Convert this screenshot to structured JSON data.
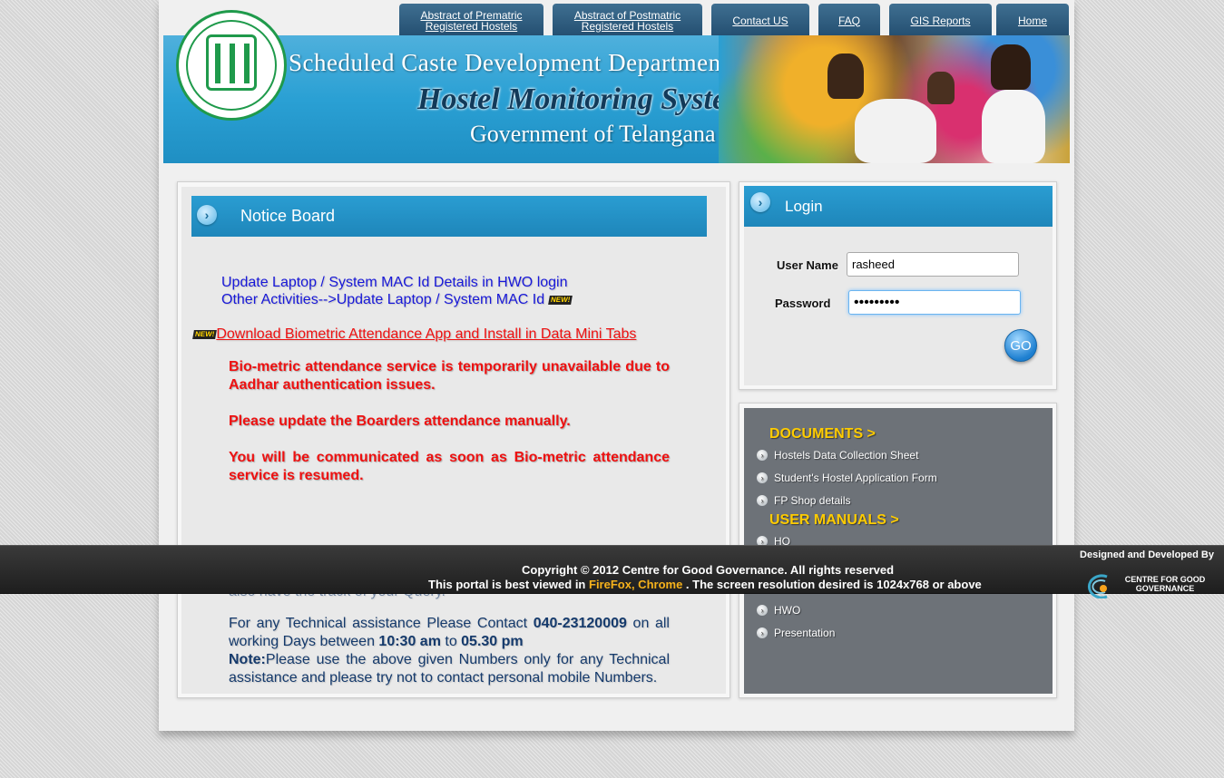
{
  "nav": {
    "items": [
      {
        "line1": "Abstract of Prematric",
        "line2": "Registered Hostels"
      },
      {
        "line1": "Abstract of Postmatric",
        "line2": "Registered Hostels"
      },
      {
        "line1": "Contact US",
        "line2": ""
      },
      {
        "line1": "FAQ",
        "line2": ""
      },
      {
        "line1": "GIS Reports",
        "line2": ""
      },
      {
        "line1": "Home",
        "line2": ""
      }
    ]
  },
  "banner": {
    "line1": "Scheduled Caste Development Department",
    "line2": "Hostel Monitoring System",
    "line3": "Government of Telangana"
  },
  "notice": {
    "title": "Notice Board",
    "mac_line1": "Update Laptop / System MAC Id Details in HWO login",
    "mac_line2": "Other Activities-->Update Laptop / System MAC Id",
    "new_badge": "NEW!",
    "download_link": "Download Biometric Attendance App and Install in Data Mini Tabs",
    "red_para1": "Bio-metric attendance service is temporarily unavailable due to Aadhar authentication issues.",
    "red_para2": "Please update the Boarders attendance manually.",
    "red_para3": "You will be communicated as soon as Bio-metric attendance service is resumed.",
    "partial_line": "also have the track of your Query.",
    "tech_pre": "For any Technical assistance Please Contact ",
    "tech_phone": "040-23120009",
    "tech_mid": " on all working Days between ",
    "tech_from": "10:30 am",
    "tech_to_word": " to ",
    "tech_to": "05.30 pm",
    "note_label": "Note:",
    "note_text": "Please use the above given Numbers only for any Technical assistance and please try not to contact personal mobile Numbers."
  },
  "login": {
    "title": "Login",
    "username_label": "User Name",
    "username_value": "rasheed",
    "password_label": "Password",
    "password_value": "•••••••••",
    "go_label": "GO"
  },
  "documents": {
    "title": "DOCUMENTS >",
    "items": [
      "Hostels Data Collection Sheet",
      "Student's Hostel Application Form",
      "FP Shop details"
    ]
  },
  "manuals": {
    "title": "USER MANUALS >",
    "items": [
      "HO",
      "HWO",
      "Presentation"
    ]
  },
  "footer": {
    "copyright": "Copyright © 2012 Centre for Good Governance. All rights reserved",
    "best_viewed_pre": "This portal is best viewed in ",
    "browsers": "FireFox, Chrome",
    "best_viewed_post": " . The screen resolution desired is 1024x768 or above",
    "designed_by": "Designed and Developed By",
    "cgg_name": "CENTRE FOR GOOD GOVERNANCE"
  },
  "colors": {
    "nav_bg": "#234e70",
    "banner_blue": "#2aa0d4",
    "notice_red": "#ee1111",
    "link_blue": "#1818d8",
    "section_yellow": "#ffcc00",
    "footer_bg": "#1e1e1e",
    "footer_highlight": "#f6b21b"
  }
}
